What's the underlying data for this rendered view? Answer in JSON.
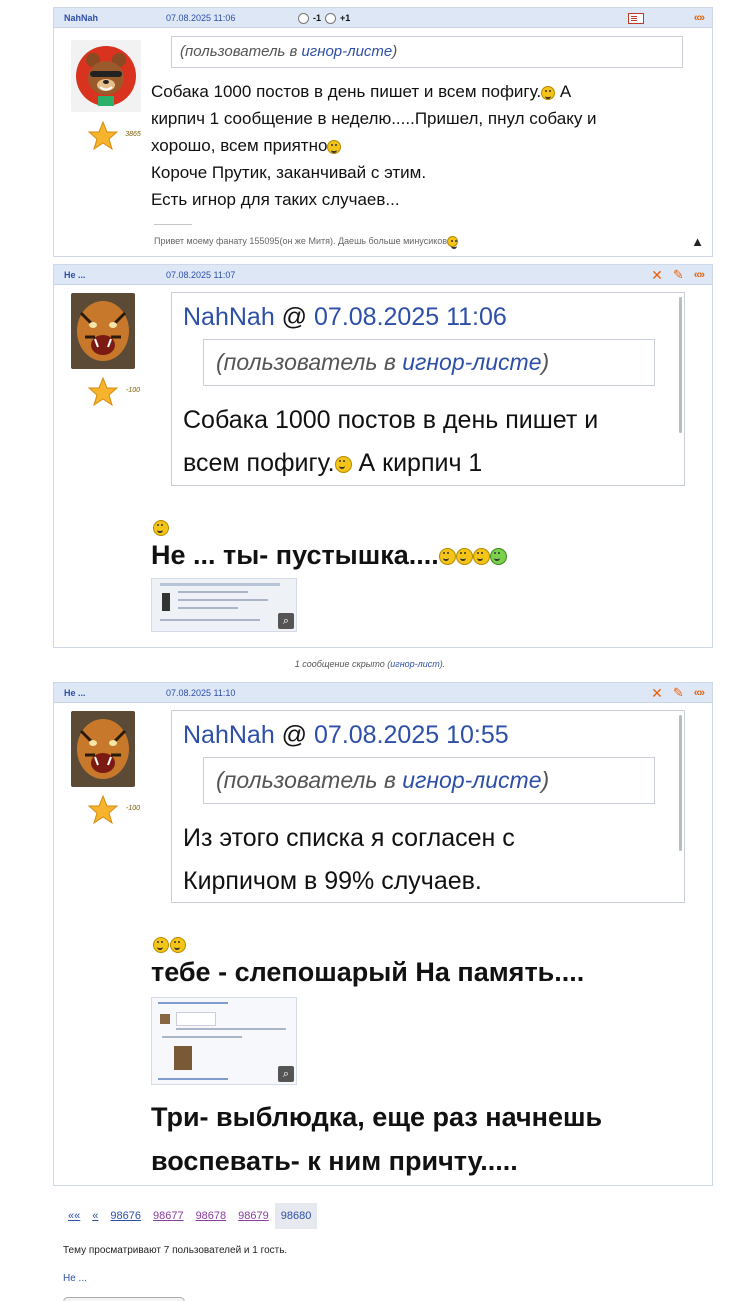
{
  "posts": [
    {
      "author": "NahNah",
      "date": "07.08.2025 11:06",
      "rate_minus": "-1",
      "rate_plus": "+1",
      "rating": "3865",
      "ignore_prefix": "(пользователь в ",
      "ignore_link": "игнор-листе",
      "ignore_suffix": ")",
      "text_line1": "Собака 1000 постов в день пишет и всем пофигу.",
      "text_line1b": " А",
      "text_line2": "кирпич 1 сообщение в неделю.....Пришел, пнул собаку и",
      "text_line3": "хорошо, всем приятно",
      "text_line4": "Короче Прутик, заканчивай с этим.",
      "text_line5": "Есть игнор для таких случаев...",
      "signature_sep": "-------------------",
      "signature": "Привет моему фанату 155095(он же Митя). Даешь больше минусиков"
    },
    {
      "author": "Не ...",
      "date": "07.08.2025 11:07",
      "rating": "-100",
      "quote_author": "NahNah",
      "quote_at": " @ ",
      "quote_date": "07.08.2025 11:06",
      "ignore_prefix": "(пользователь в ",
      "ignore_link": "игнор-листе",
      "ignore_suffix": ")",
      "quote_line1": "Собака 1000 постов в день пишет и",
      "quote_line2a": "всем пофигу.",
      "quote_line2b": " А кирпич 1",
      "big_text": "Не ... ты- пустышка...."
    },
    {
      "author": "Не ...",
      "date": "07.08.2025 11:10",
      "rating": "-100",
      "quote_author": "NahNah",
      "quote_at": " @ ",
      "quote_date": "07.08.2025 10:55",
      "ignore_prefix": "(пользователь в ",
      "ignore_link": "игнор-листе",
      "ignore_suffix": ")",
      "quote_line1": "Из этого списка я согласен с",
      "quote_line2": "Кирпичом в 99% случаев.",
      "big_text1": "тебе - слепошарый На память....",
      "big_text2": "Три- выблюдка, еще раз начнешь",
      "big_text3": "воспевать- к ним причту....."
    }
  ],
  "hidden_notice_prefix": "1 сообщение скрыто (",
  "hidden_notice_link": "игнор-лист",
  "hidden_notice_suffix": ").",
  "pager": {
    "first": "««",
    "prev": "«",
    "pages": [
      "98676",
      "98677",
      "98678",
      "98679",
      "98680"
    ],
    "current": "98680"
  },
  "viewers_text": "Тему просматривают 7 пользователей и 1 гость.",
  "viewer_name": "Не ...",
  "icons": {
    "quote": "quote-icon",
    "delete": "x-icon",
    "edit": "pencil-icon",
    "profile": "card-icon",
    "warning": "warning-icon",
    "zoom": "zoom-icon"
  }
}
